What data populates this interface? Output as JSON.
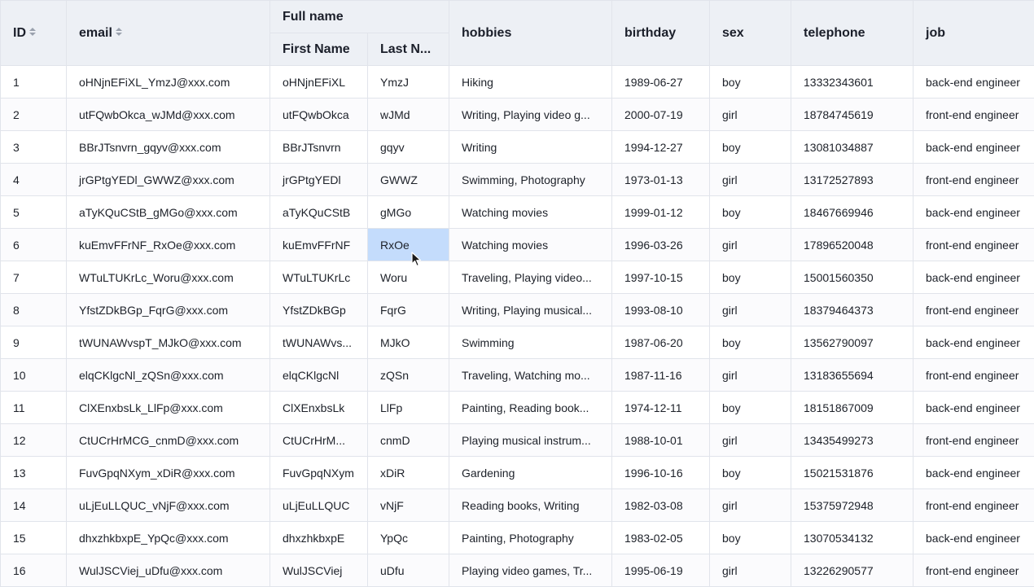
{
  "headers": {
    "id": "ID",
    "email": "email",
    "full_name": "Full name",
    "first_name": "First Name",
    "last_name": "Last N...",
    "hobbies": "hobbies",
    "birthday": "birthday",
    "sex": "sex",
    "telephone": "telephone",
    "job": "job"
  },
  "icons": {
    "sort": "sort-icon",
    "cursor": "mouse-pointer-icon"
  },
  "colors": {
    "header_bg": "#edf0f5",
    "border": "#e1e4eb",
    "selected_cell": "#c4dcfc"
  },
  "selected": {
    "row": 6,
    "column": "last_name"
  },
  "rows": [
    {
      "id": "1",
      "email": "oHNjnEFiXL_YmzJ@xxx.com",
      "first": "oHNjnEFiXL",
      "last": "YmzJ",
      "hobbies": "Hiking",
      "birthday": "1989-06-27",
      "sex": "boy",
      "tel": "13332343601",
      "job": "back-end engineer"
    },
    {
      "id": "2",
      "email": "utFQwbOkca_wJMd@xxx.com",
      "first": "utFQwbOkca",
      "last": "wJMd",
      "hobbies": "Writing, Playing video g...",
      "birthday": "2000-07-19",
      "sex": "girl",
      "tel": "18784745619",
      "job": "front-end engineer"
    },
    {
      "id": "3",
      "email": "BBrJTsnvrn_gqyv@xxx.com",
      "first": "BBrJTsnvrn",
      "last": "gqyv",
      "hobbies": "Writing",
      "birthday": "1994-12-27",
      "sex": "boy",
      "tel": "13081034887",
      "job": "back-end engineer"
    },
    {
      "id": "4",
      "email": "jrGPtgYEDl_GWWZ@xxx.com",
      "first": "jrGPtgYEDl",
      "last": "GWWZ",
      "hobbies": "Swimming, Photography",
      "birthday": "1973-01-13",
      "sex": "girl",
      "tel": "13172527893",
      "job": "front-end engineer"
    },
    {
      "id": "5",
      "email": "aTyKQuCStB_gMGo@xxx.com",
      "first": "aTyKQuCStB",
      "last": "gMGo",
      "hobbies": "Watching movies",
      "birthday": "1999-01-12",
      "sex": "boy",
      "tel": "18467669946",
      "job": "back-end engineer"
    },
    {
      "id": "6",
      "email": "kuEmvFFrNF_RxOe@xxx.com",
      "first": "kuEmvFFrNF",
      "last": "RxOe",
      "hobbies": "Watching movies",
      "birthday": "1996-03-26",
      "sex": "girl",
      "tel": "17896520048",
      "job": "front-end engineer"
    },
    {
      "id": "7",
      "email": "WTuLTUKrLc_Woru@xxx.com",
      "first": "WTuLTUKrLc",
      "last": "Woru",
      "hobbies": "Traveling, Playing video...",
      "birthday": "1997-10-15",
      "sex": "boy",
      "tel": "15001560350",
      "job": "back-end engineer"
    },
    {
      "id": "8",
      "email": "YfstZDkBGp_FqrG@xxx.com",
      "first": "YfstZDkBGp",
      "last": "FqrG",
      "hobbies": "Writing, Playing musical...",
      "birthday": "1993-08-10",
      "sex": "girl",
      "tel": "18379464373",
      "job": "front-end engineer"
    },
    {
      "id": "9",
      "email": "tWUNAWvspT_MJkO@xxx.com",
      "first": "tWUNAWvs...",
      "last": "MJkO",
      "hobbies": "Swimming",
      "birthday": "1987-06-20",
      "sex": "boy",
      "tel": "13562790097",
      "job": "back-end engineer"
    },
    {
      "id": "10",
      "email": "elqCKlgcNl_zQSn@xxx.com",
      "first": "elqCKlgcNl",
      "last": "zQSn",
      "hobbies": "Traveling, Watching mo...",
      "birthday": "1987-11-16",
      "sex": "girl",
      "tel": "13183655694",
      "job": "front-end engineer"
    },
    {
      "id": "11",
      "email": "ClXEnxbsLk_LlFp@xxx.com",
      "first": "ClXEnxbsLk",
      "last": "LlFp",
      "hobbies": "Painting, Reading book...",
      "birthday": "1974-12-11",
      "sex": "boy",
      "tel": "18151867009",
      "job": "back-end engineer"
    },
    {
      "id": "12",
      "email": "CtUCrHrMCG_cnmD@xxx.com",
      "first": "CtUCrHrM...",
      "last": "cnmD",
      "hobbies": "Playing musical instrum...",
      "birthday": "1988-10-01",
      "sex": "girl",
      "tel": "13435499273",
      "job": "front-end engineer"
    },
    {
      "id": "13",
      "email": "FuvGpqNXym_xDiR@xxx.com",
      "first": "FuvGpqNXym",
      "last": "xDiR",
      "hobbies": "Gardening",
      "birthday": "1996-10-16",
      "sex": "boy",
      "tel": "15021531876",
      "job": "back-end engineer"
    },
    {
      "id": "14",
      "email": "uLjEuLLQUC_vNjF@xxx.com",
      "first": "uLjEuLLQUC",
      "last": "vNjF",
      "hobbies": "Reading books, Writing",
      "birthday": "1982-03-08",
      "sex": "girl",
      "tel": "15375972948",
      "job": "front-end engineer"
    },
    {
      "id": "15",
      "email": "dhxzhkbxpE_YpQc@xxx.com",
      "first": "dhxzhkbxpE",
      "last": "YpQc",
      "hobbies": "Painting, Photography",
      "birthday": "1983-02-05",
      "sex": "boy",
      "tel": "13070534132",
      "job": "back-end engineer"
    },
    {
      "id": "16",
      "email": "WulJSCViej_uDfu@xxx.com",
      "first": "WulJSCViej",
      "last": "uDfu",
      "hobbies": "Playing video games, Tr...",
      "birthday": "1995-06-19",
      "sex": "girl",
      "tel": "13226290577",
      "job": "front-end engineer"
    }
  ]
}
